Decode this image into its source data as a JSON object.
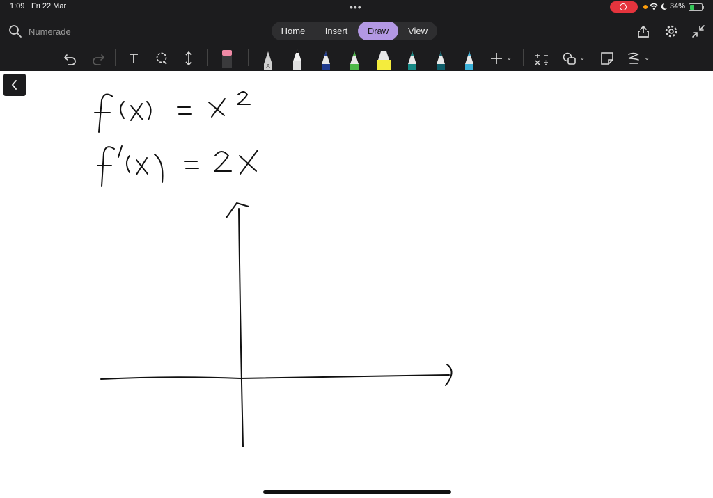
{
  "status_bar": {
    "time": "1:09",
    "date": "Fri 22 Mar",
    "battery": "34%"
  },
  "header": {
    "search_label": "Numerade",
    "tabs": [
      {
        "label": "Home"
      },
      {
        "label": "Insert"
      },
      {
        "label": "Draw",
        "active": true
      },
      {
        "label": "View"
      }
    ]
  },
  "toolbar": {
    "tools": [
      "undo-icon",
      "redo-icon",
      "text-tool-icon",
      "lasso-icon",
      "add-space-icon",
      "eraser-icon",
      "pen-A-icon",
      "pen-black-icon",
      "pen-navy-icon",
      "pen-green-icon",
      "highlighter-yellow-icon",
      "pen-teal-icon",
      "pen-dark-teal-icon",
      "pen-cyan-icon",
      "add-pen-icon",
      "math-icon",
      "shapes-icon",
      "sticky-note-icon",
      "ink-to-text-icon"
    ],
    "colors": {
      "active_tab": "#b398e4",
      "record": "#e5343d",
      "battery": "#34c759",
      "pen_navy": "#1f3b8f",
      "pen_green": "#4cb848",
      "highlighter": "#f4ec3d",
      "pen_teal": "#178a86",
      "pen_dark_teal": "#0f5e6a",
      "pen_cyan": "#3ab0d8"
    }
  },
  "canvas": {
    "handwriting": [
      "f(x) = x²",
      "f′(x) = 2x"
    ]
  }
}
